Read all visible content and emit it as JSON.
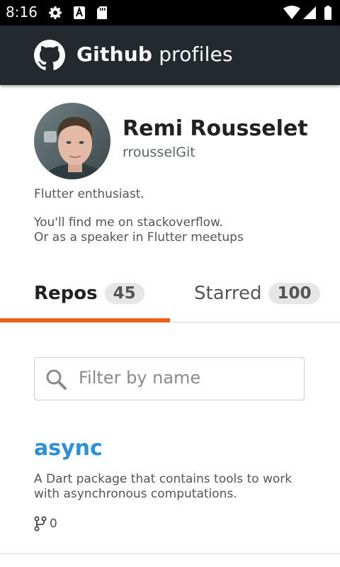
{
  "status_bar": {
    "time": "8:16",
    "icons": [
      "gear-icon",
      "text-a-icon",
      "sd-card-icon",
      "wifi-icon",
      "signal-icon",
      "battery-icon"
    ]
  },
  "app_bar": {
    "title_bold": "Github",
    "title_rest": "profiles",
    "background": "#24292e"
  },
  "profile": {
    "name": "Remi Rousselet",
    "login": "rrousselGit",
    "bio_lines": [
      "Flutter enthusiast.",
      "You'll find me on stackoverflow.",
      "Or as a speaker in Flutter meetups"
    ]
  },
  "tabs": [
    {
      "label": "Repos",
      "count": "45",
      "selected": true
    },
    {
      "label": "Starred",
      "count": "100",
      "selected": false
    }
  ],
  "accent_color": "#e8621c",
  "link_color": "#2c8fd8",
  "search": {
    "placeholder": "Filter by name",
    "value": ""
  },
  "repos": [
    {
      "name": "async",
      "description": "A Dart package that contains tools to work with asynchronous computations.",
      "forks": "0"
    }
  ]
}
